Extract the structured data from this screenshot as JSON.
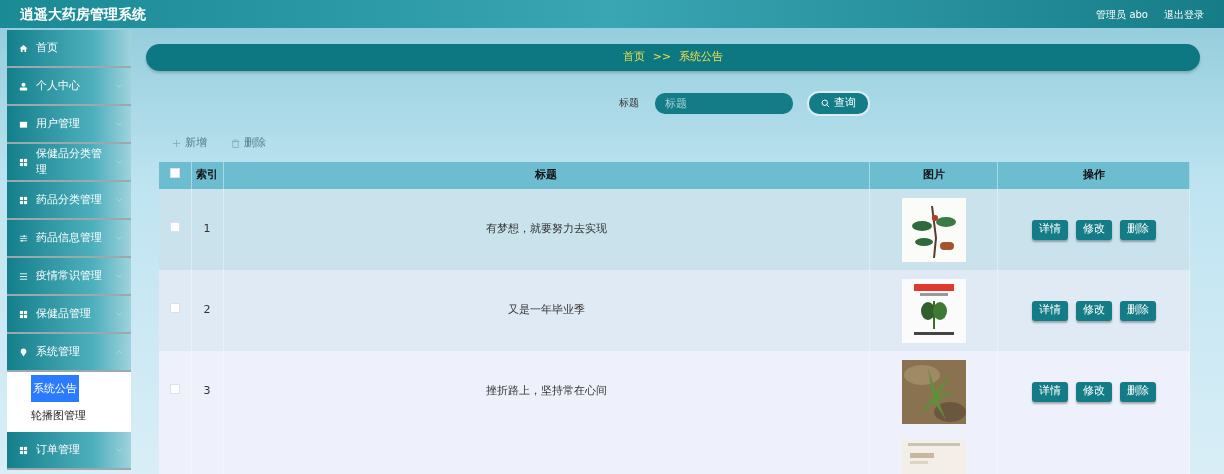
{
  "header": {
    "title": "逍遥大药房管理系统",
    "user": "管理员 abo",
    "logout": "退出登录"
  },
  "sidebar": {
    "items": [
      {
        "label": "首页"
      },
      {
        "label": "个人中心",
        "expanded": false
      },
      {
        "label": "用户管理",
        "expanded": false
      },
      {
        "label": "保健品分类管理",
        "expanded": false
      },
      {
        "label": "药品分类管理",
        "expanded": false
      },
      {
        "label": "药品信息管理",
        "expanded": false
      },
      {
        "label": "疫情常识管理",
        "expanded": false
      },
      {
        "label": "保健品管理",
        "expanded": false
      },
      {
        "label": "系统管理",
        "expanded": true,
        "children": [
          {
            "label": "系统公告",
            "selected": true
          },
          {
            "label": "轮播图管理",
            "selected": false
          }
        ]
      },
      {
        "label": "订单管理",
        "expanded": false
      }
    ]
  },
  "breadcrumb": [
    "首页",
    ">>",
    "系统公告"
  ],
  "search": {
    "label": "标题",
    "placeholder": "标题",
    "button": "查询"
  },
  "toolbar": [
    "新增",
    "删除"
  ],
  "table": {
    "select_all_checked": false,
    "columns": [
      "索引",
      "标题",
      "图片",
      "操作"
    ],
    "rows": [
      {
        "checked": false,
        "hovered": true,
        "index": "1",
        "title": "有梦想，就要努力去实现",
        "actions": [
          "详情",
          "修改",
          "删除"
        ]
      },
      {
        "checked": false,
        "hovered": false,
        "index": "2",
        "title": "又是一年毕业季",
        "actions": [
          "详情",
          "修改",
          "删除"
        ]
      },
      {
        "checked": false,
        "hovered": false,
        "index": "3",
        "title": "挫折路上，坚持常在心间",
        "actions": [
          "详情",
          "修改",
          "删除"
        ]
      },
      {
        "kind": "partial"
      }
    ]
  }
}
